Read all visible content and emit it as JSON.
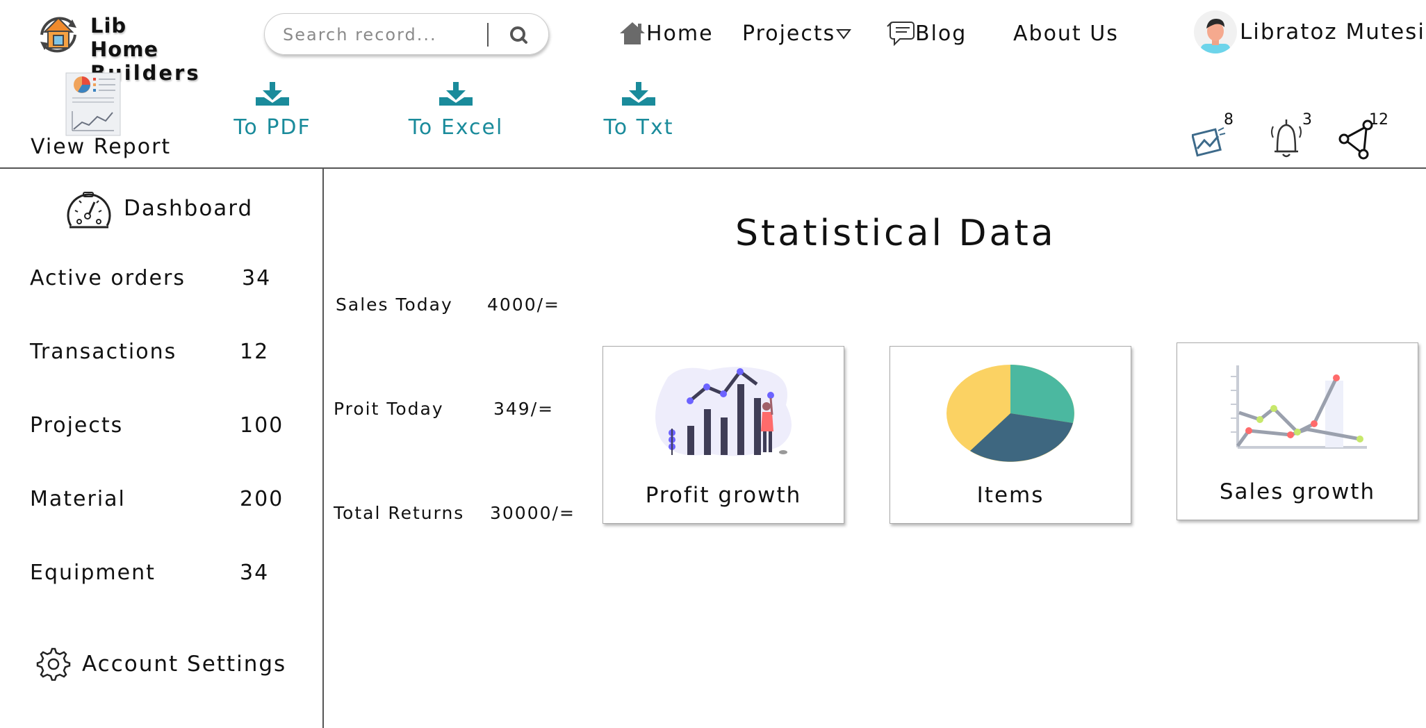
{
  "app": {
    "logo_line1": "Lib Home",
    "logo_line2": "Builders"
  },
  "search": {
    "placeholder": "Search record...",
    "value": ""
  },
  "nav": {
    "home": "Home",
    "projects": "Projects",
    "blog": "Blog",
    "about": "About Us"
  },
  "user": {
    "name": "Libratoz Mutesi"
  },
  "toolbar": {
    "view_report": "View Report",
    "to_pdf": "To PDF",
    "to_excel": "To Excel",
    "to_txt": "To Txt"
  },
  "notifications": {
    "messages": "8",
    "alerts": "3",
    "shares": "12"
  },
  "sidebar": {
    "dashboard": "Dashboard",
    "items": [
      {
        "label": "Active orders",
        "count": "34"
      },
      {
        "label": "Transactions",
        "count": "12"
      },
      {
        "label": "Projects",
        "count": "100"
      },
      {
        "label": "Material",
        "count": "200"
      },
      {
        "label": "Equipment",
        "count": "34"
      }
    ],
    "settings": "Account Settings"
  },
  "main": {
    "title": "Statistical Data",
    "stats": [
      {
        "label": "Sales Today",
        "value": "4000/="
      },
      {
        "label": "Proit Today",
        "value": "349/="
      },
      {
        "label": "Total Returns",
        "value": "30000/="
      }
    ],
    "cards": [
      {
        "label": "Profit growth",
        "icon": "bar-chart-illustration"
      },
      {
        "label": "Items",
        "icon": "pie-chart-illustration"
      },
      {
        "label": "Sales growth",
        "icon": "line-chart-illustration"
      }
    ]
  },
  "colors": {
    "accent": "#1a8b9b",
    "divider": "#555555",
    "pie_teal": "#4bb8a0",
    "pie_yellow": "#fbd263",
    "pie_slate": "#3e6780"
  }
}
